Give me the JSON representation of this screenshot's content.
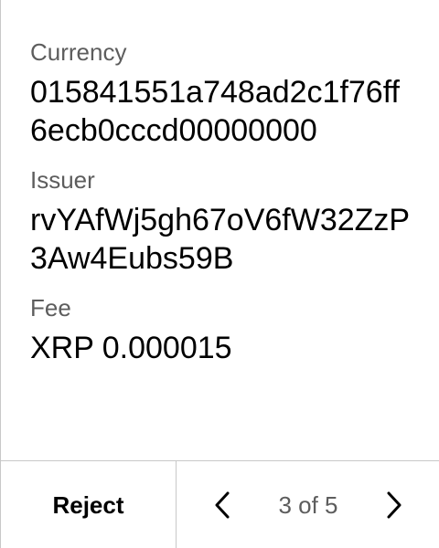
{
  "fields": [
    {
      "label": "Currency",
      "value": "015841551a748ad2c1f76ff6ecb0cccd00000000"
    },
    {
      "label": "Issuer",
      "value": "rvYAfWj5gh67oV6fW32ZzP3Aw4Eubs59B"
    },
    {
      "label": "Fee",
      "value": "XRP 0.000015"
    }
  ],
  "footer": {
    "reject_label": "Reject",
    "page_indicator": "3 of 5",
    "prev_icon": "chevron-left-icon",
    "next_icon": "chevron-right-icon"
  }
}
